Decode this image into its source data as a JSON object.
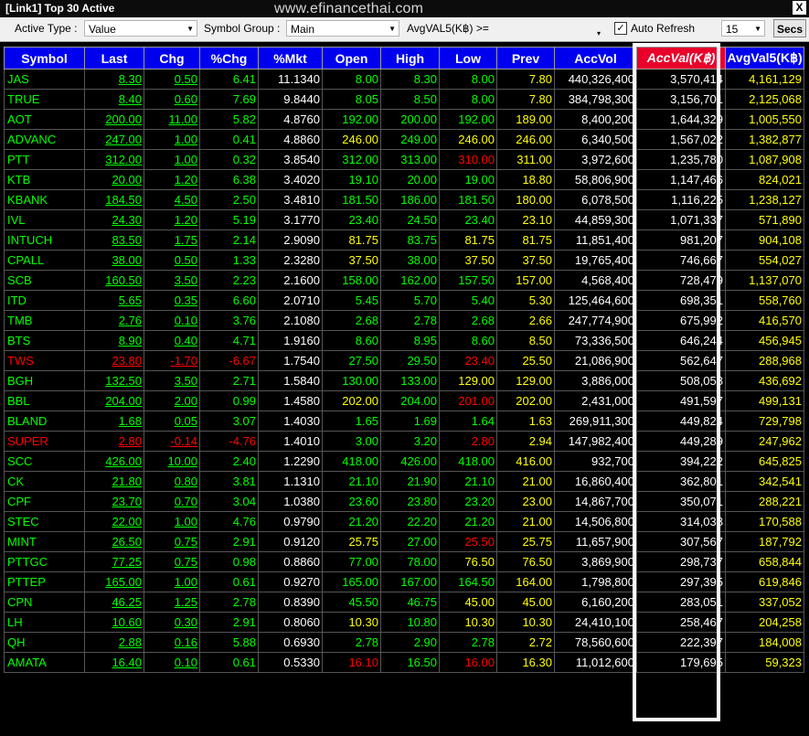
{
  "window": {
    "title": "[Link1] Top 30 Active",
    "watermark": "www.efinancethai.com",
    "close_label": "X"
  },
  "toolbar": {
    "active_type_label": "Active Type :",
    "active_type_value": "Value",
    "symbol_group_label": "Symbol Group :",
    "symbol_group_value": "Main",
    "avg_filter_label": "AvgVAL5(K฿) >=",
    "avg_filter_value": "",
    "auto_refresh_label": "Auto Refresh",
    "auto_refresh_checked": true,
    "interval_value": "15",
    "secs_label": "Secs"
  },
  "columns": [
    "Symbol",
    "Last",
    "Chg",
    "%Chg",
    "%Mkt",
    "Open",
    "High",
    "Low",
    "Prev",
    "AccVol",
    "AccVal(K฿)",
    "AvgVal5(K฿)"
  ],
  "rows": [
    {
      "symbol": "JAS",
      "dir": "up",
      "last": "8.30",
      "chg": "0.50",
      "pchg": "6.41",
      "mkt": "11.1340",
      "open": "8.00",
      "high": "8.30",
      "low": "8.00",
      "prev": "7.80",
      "accvol": "440,326,400",
      "accval": "3,570,414",
      "avgval5": "4,161,129",
      "oc": "g",
      "hc": "g",
      "lc": "g"
    },
    {
      "symbol": "TRUE",
      "dir": "up",
      "last": "8.40",
      "chg": "0.60",
      "pchg": "7.69",
      "mkt": "9.8440",
      "open": "8.05",
      "high": "8.50",
      "low": "8.00",
      "prev": "7.80",
      "accvol": "384,798,300",
      "accval": "3,156,701",
      "avgval5": "2,125,068",
      "oc": "g",
      "hc": "g",
      "lc": "g"
    },
    {
      "symbol": "AOT",
      "dir": "up",
      "last": "200.00",
      "chg": "11.00",
      "pchg": "5.82",
      "mkt": "4.8760",
      "open": "192.00",
      "high": "200.00",
      "low": "192.00",
      "prev": "189.00",
      "accvol": "8,400,200",
      "accval": "1,644,329",
      "avgval5": "1,005,550",
      "oc": "g",
      "hc": "g",
      "lc": "g"
    },
    {
      "symbol": "ADVANC",
      "dir": "up",
      "last": "247.00",
      "chg": "1.00",
      "pchg": "0.41",
      "mkt": "4.8860",
      "open": "246.00",
      "high": "249.00",
      "low": "246.00",
      "prev": "246.00",
      "accvol": "6,340,500",
      "accval": "1,567,022",
      "avgval5": "1,382,877",
      "oc": "y",
      "hc": "g",
      "lc": "y"
    },
    {
      "symbol": "PTT",
      "dir": "up",
      "last": "312.00",
      "chg": "1.00",
      "pchg": "0.32",
      "mkt": "3.8540",
      "open": "312.00",
      "high": "313.00",
      "low": "310.00",
      "prev": "311.00",
      "accvol": "3,972,600",
      "accval": "1,235,780",
      "avgval5": "1,087,908",
      "oc": "g",
      "hc": "g",
      "lc": "red"
    },
    {
      "symbol": "KTB",
      "dir": "up",
      "last": "20.00",
      "chg": "1.20",
      "pchg": "6.38",
      "mkt": "3.4020",
      "open": "19.10",
      "high": "20.00",
      "low": "19.00",
      "prev": "18.80",
      "accvol": "58,806,900",
      "accval": "1,147,466",
      "avgval5": "824,021",
      "oc": "g",
      "hc": "g",
      "lc": "g"
    },
    {
      "symbol": "KBANK",
      "dir": "up",
      "last": "184.50",
      "chg": "4.50",
      "pchg": "2.50",
      "mkt": "3.4810",
      "open": "181.50",
      "high": "186.00",
      "low": "181.50",
      "prev": "180.00",
      "accvol": "6,078,500",
      "accval": "1,116,225",
      "avgval5": "1,238,127",
      "oc": "g",
      "hc": "g",
      "lc": "g"
    },
    {
      "symbol": "IVL",
      "dir": "up",
      "last": "24.30",
      "chg": "1.20",
      "pchg": "5.19",
      "mkt": "3.1770",
      "open": "23.40",
      "high": "24.50",
      "low": "23.40",
      "prev": "23.10",
      "accvol": "44,859,300",
      "accval": "1,071,337",
      "avgval5": "571,890",
      "oc": "g",
      "hc": "g",
      "lc": "g"
    },
    {
      "symbol": "INTUCH",
      "dir": "up",
      "last": "83.50",
      "chg": "1.75",
      "pchg": "2.14",
      "mkt": "2.9090",
      "open": "81.75",
      "high": "83.75",
      "low": "81.75",
      "prev": "81.75",
      "accvol": "11,851,400",
      "accval": "981,207",
      "avgval5": "904,108",
      "oc": "y",
      "hc": "g",
      "lc": "y"
    },
    {
      "symbol": "CPALL",
      "dir": "up",
      "last": "38.00",
      "chg": "0.50",
      "pchg": "1.33",
      "mkt": "2.3280",
      "open": "37.50",
      "high": "38.00",
      "low": "37.50",
      "prev": "37.50",
      "accvol": "19,765,400",
      "accval": "746,667",
      "avgval5": "554,027",
      "oc": "y",
      "hc": "g",
      "lc": "y"
    },
    {
      "symbol": "SCB",
      "dir": "up",
      "last": "160.50",
      "chg": "3.50",
      "pchg": "2.23",
      "mkt": "2.1600",
      "open": "158.00",
      "high": "162.00",
      "low": "157.50",
      "prev": "157.00",
      "accvol": "4,568,400",
      "accval": "728,479",
      "avgval5": "1,137,070",
      "oc": "g",
      "hc": "g",
      "lc": "g"
    },
    {
      "symbol": "ITD",
      "dir": "up",
      "last": "5.65",
      "chg": "0.35",
      "pchg": "6.60",
      "mkt": "2.0710",
      "open": "5.45",
      "high": "5.70",
      "low": "5.40",
      "prev": "5.30",
      "accvol": "125,464,600",
      "accval": "698,351",
      "avgval5": "558,760",
      "oc": "g",
      "hc": "g",
      "lc": "g"
    },
    {
      "symbol": "TMB",
      "dir": "up",
      "last": "2.76",
      "chg": "0.10",
      "pchg": "3.76",
      "mkt": "2.1080",
      "open": "2.68",
      "high": "2.78",
      "low": "2.68",
      "prev": "2.66",
      "accvol": "247,774,900",
      "accval": "675,992",
      "avgval5": "416,570",
      "oc": "g",
      "hc": "g",
      "lc": "g"
    },
    {
      "symbol": "BTS",
      "dir": "up",
      "last": "8.90",
      "chg": "0.40",
      "pchg": "4.71",
      "mkt": "1.9160",
      "open": "8.60",
      "high": "8.95",
      "low": "8.60",
      "prev": "8.50",
      "accvol": "73,336,500",
      "accval": "646,244",
      "avgval5": "456,945",
      "oc": "g",
      "hc": "g",
      "lc": "g"
    },
    {
      "symbol": "TWS",
      "dir": "down",
      "last": "23.80",
      "chg": "-1.70",
      "pchg": "-6.67",
      "mkt": "1.7540",
      "open": "27.50",
      "high": "29.50",
      "low": "23.40",
      "prev": "25.50",
      "accvol": "21,086,900",
      "accval": "562,647",
      "avgval5": "288,968",
      "oc": "g",
      "hc": "g",
      "lc": "red"
    },
    {
      "symbol": "BGH",
      "dir": "up",
      "last": "132.50",
      "chg": "3.50",
      "pchg": "2.71",
      "mkt": "1.5840",
      "open": "130.00",
      "high": "133.00",
      "low": "129.00",
      "prev": "129.00",
      "accvol": "3,886,000",
      "accval": "508,058",
      "avgval5": "436,692",
      "oc": "g",
      "hc": "g",
      "lc": "y"
    },
    {
      "symbol": "BBL",
      "dir": "up",
      "last": "204.00",
      "chg": "2.00",
      "pchg": "0.99",
      "mkt": "1.4580",
      "open": "202.00",
      "high": "204.00",
      "low": "201.00",
      "prev": "202.00",
      "accvol": "2,431,000",
      "accval": "491,597",
      "avgval5": "499,131",
      "oc": "y",
      "hc": "g",
      "lc": "red"
    },
    {
      "symbol": "BLAND",
      "dir": "up",
      "last": "1.68",
      "chg": "0.05",
      "pchg": "3.07",
      "mkt": "1.4030",
      "open": "1.65",
      "high": "1.69",
      "low": "1.64",
      "prev": "1.63",
      "accvol": "269,911,300",
      "accval": "449,824",
      "avgval5": "729,798",
      "oc": "g",
      "hc": "g",
      "lc": "g"
    },
    {
      "symbol": "SUPER",
      "dir": "down",
      "last": "2.80",
      "chg": "-0.14",
      "pchg": "-4.76",
      "mkt": "1.4010",
      "open": "3.00",
      "high": "3.20",
      "low": "2.80",
      "prev": "2.94",
      "accvol": "147,982,400",
      "accval": "449,289",
      "avgval5": "247,962",
      "oc": "g",
      "hc": "g",
      "lc": "red"
    },
    {
      "symbol": "SCC",
      "dir": "up",
      "last": "426.00",
      "chg": "10.00",
      "pchg": "2.40",
      "mkt": "1.2290",
      "open": "418.00",
      "high": "426.00",
      "low": "418.00",
      "prev": "416.00",
      "accvol": "932,700",
      "accval": "394,222",
      "avgval5": "645,825",
      "oc": "g",
      "hc": "g",
      "lc": "g"
    },
    {
      "symbol": "CK",
      "dir": "up",
      "last": "21.80",
      "chg": "0.80",
      "pchg": "3.81",
      "mkt": "1.1310",
      "open": "21.10",
      "high": "21.90",
      "low": "21.10",
      "prev": "21.00",
      "accvol": "16,860,400",
      "accval": "362,801",
      "avgval5": "342,541",
      "oc": "g",
      "hc": "g",
      "lc": "g"
    },
    {
      "symbol": "CPF",
      "dir": "up",
      "last": "23.70",
      "chg": "0.70",
      "pchg": "3.04",
      "mkt": "1.0380",
      "open": "23.60",
      "high": "23.80",
      "low": "23.20",
      "prev": "23.00",
      "accvol": "14,867,700",
      "accval": "350,071",
      "avgval5": "288,221",
      "oc": "g",
      "hc": "g",
      "lc": "g"
    },
    {
      "symbol": "STEC",
      "dir": "up",
      "last": "22.00",
      "chg": "1.00",
      "pchg": "4.76",
      "mkt": "0.9790",
      "open": "21.20",
      "high": "22.20",
      "low": "21.20",
      "prev": "21.00",
      "accvol": "14,506,800",
      "accval": "314,038",
      "avgval5": "170,588",
      "oc": "g",
      "hc": "g",
      "lc": "g"
    },
    {
      "symbol": "MINT",
      "dir": "up",
      "last": "26.50",
      "chg": "0.75",
      "pchg": "2.91",
      "mkt": "0.9120",
      "open": "25.75",
      "high": "27.00",
      "low": "25.50",
      "prev": "25.75",
      "accvol": "11,657,900",
      "accval": "307,567",
      "avgval5": "187,792",
      "oc": "y",
      "hc": "g",
      "lc": "red"
    },
    {
      "symbol": "PTTGC",
      "dir": "up",
      "last": "77.25",
      "chg": "0.75",
      "pchg": "0.98",
      "mkt": "0.8860",
      "open": "77.00",
      "high": "78.00",
      "low": "76.50",
      "prev": "76.50",
      "accvol": "3,869,900",
      "accval": "298,737",
      "avgval5": "658,844",
      "oc": "g",
      "hc": "g",
      "lc": "y"
    },
    {
      "symbol": "PTTEP",
      "dir": "up",
      "last": "165.00",
      "chg": "1.00",
      "pchg": "0.61",
      "mkt": "0.9270",
      "open": "165.00",
      "high": "167.00",
      "low": "164.50",
      "prev": "164.00",
      "accvol": "1,798,800",
      "accval": "297,395",
      "avgval5": "619,846",
      "oc": "g",
      "hc": "g",
      "lc": "g"
    },
    {
      "symbol": "CPN",
      "dir": "up",
      "last": "46.25",
      "chg": "1.25",
      "pchg": "2.78",
      "mkt": "0.8390",
      "open": "45.50",
      "high": "46.75",
      "low": "45.00",
      "prev": "45.00",
      "accvol": "6,160,200",
      "accval": "283,051",
      "avgval5": "337,052",
      "oc": "g",
      "hc": "g",
      "lc": "y"
    },
    {
      "symbol": "LH",
      "dir": "up",
      "last": "10.60",
      "chg": "0.30",
      "pchg": "2.91",
      "mkt": "0.8060",
      "open": "10.30",
      "high": "10.80",
      "low": "10.30",
      "prev": "10.30",
      "accvol": "24,410,100",
      "accval": "258,467",
      "avgval5": "204,258",
      "oc": "y",
      "hc": "g",
      "lc": "y"
    },
    {
      "symbol": "QH",
      "dir": "up",
      "last": "2.88",
      "chg": "0.16",
      "pchg": "5.88",
      "mkt": "0.6930",
      "open": "2.78",
      "high": "2.90",
      "low": "2.78",
      "prev": "2.72",
      "accvol": "78,560,600",
      "accval": "222,397",
      "avgval5": "184,008",
      "oc": "g",
      "hc": "g",
      "lc": "g"
    },
    {
      "symbol": "AMATA",
      "dir": "up",
      "last": "16.40",
      "chg": "0.10",
      "pchg": "0.61",
      "mkt": "0.5330",
      "open": "16.10",
      "high": "16.50",
      "low": "16.00",
      "prev": "16.30",
      "accvol": "11,012,600",
      "accval": "179,695",
      "avgval5": "59,323",
      "oc": "red",
      "hc": "g",
      "lc": "red"
    }
  ]
}
